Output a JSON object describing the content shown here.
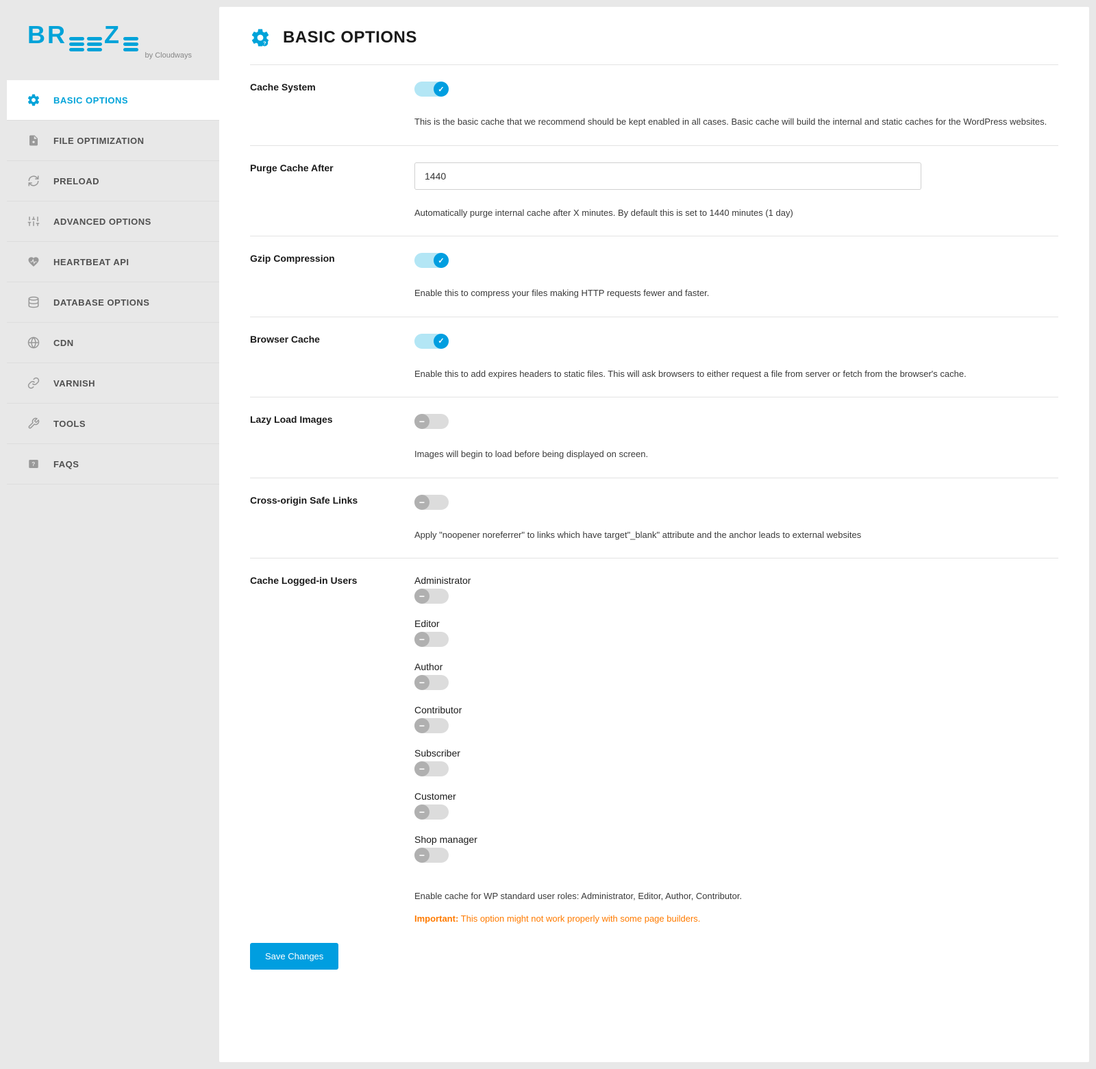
{
  "brand": {
    "name": "BREEZE",
    "byline": "by Cloudways"
  },
  "nav": [
    {
      "label": "BASIC OPTIONS",
      "active": true,
      "icon": "gear-icon"
    },
    {
      "label": "FILE OPTIMIZATION",
      "active": false,
      "icon": "file-gear-icon"
    },
    {
      "label": "PRELOAD",
      "active": false,
      "icon": "refresh-icon"
    },
    {
      "label": "ADVANCED OPTIONS",
      "active": false,
      "icon": "sliders-icon"
    },
    {
      "label": "HEARTBEAT API",
      "active": false,
      "icon": "heartbeat-icon"
    },
    {
      "label": "DATABASE OPTIONS",
      "active": false,
      "icon": "database-icon"
    },
    {
      "label": "CDN",
      "active": false,
      "icon": "globe-icon"
    },
    {
      "label": "VARNISH",
      "active": false,
      "icon": "link-icon"
    },
    {
      "label": "TOOLS",
      "active": false,
      "icon": "tools-icon"
    },
    {
      "label": "FAQS",
      "active": false,
      "icon": "faq-icon"
    }
  ],
  "page": {
    "title": "BASIC OPTIONS"
  },
  "settings": {
    "cache_system": {
      "label": "Cache System",
      "on": true,
      "desc": "This is the basic cache that we recommend should be kept enabled in all cases. Basic cache will build the internal and static caches for the WordPress websites."
    },
    "purge_cache": {
      "label": "Purge Cache After",
      "value": "1440",
      "desc": "Automatically purge internal cache after X minutes. By default this is set to 1440 minutes (1 day)"
    },
    "gzip": {
      "label": "Gzip Compression",
      "on": true,
      "desc": "Enable this to compress your files making HTTP requests fewer and faster."
    },
    "browser_cache": {
      "label": "Browser Cache",
      "on": true,
      "desc": "Enable this to add expires headers to static files. This will ask browsers to either request a file from server or fetch from the browser's cache."
    },
    "lazy_load": {
      "label": "Lazy Load Images",
      "on": false,
      "desc": "Images will begin to load before being displayed on screen."
    },
    "cross_origin": {
      "label": "Cross-origin Safe Links",
      "on": false,
      "desc": "Apply \"noopener noreferrer\" to links which have target\"_blank\" attribute and the anchor leads to external websites"
    },
    "cache_logged": {
      "label": "Cache Logged-in Users",
      "roles": [
        {
          "name": "Administrator",
          "on": false
        },
        {
          "name": "Editor",
          "on": false
        },
        {
          "name": "Author",
          "on": false
        },
        {
          "name": "Contributor",
          "on": false
        },
        {
          "name": "Subscriber",
          "on": false
        },
        {
          "name": "Customer",
          "on": false
        },
        {
          "name": "Shop manager",
          "on": false
        }
      ],
      "desc": "Enable cache for WP standard user roles: Administrator, Editor, Author, Contributor.",
      "important_label": "Important:",
      "important_text": " This option might not work properly with some page builders."
    }
  },
  "save_button": "Save Changes"
}
